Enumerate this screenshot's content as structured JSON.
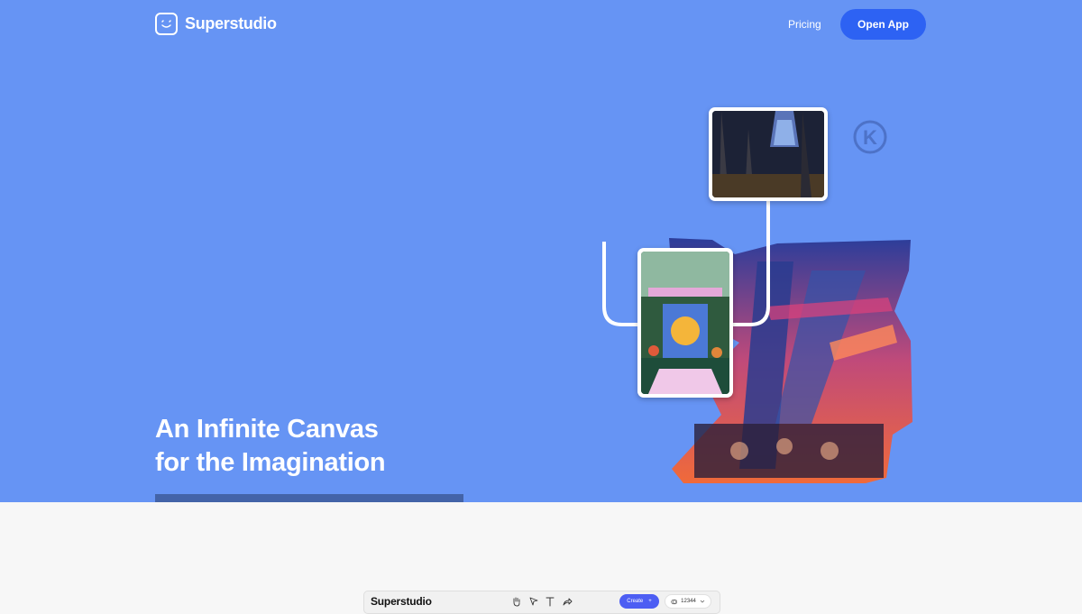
{
  "nav": {
    "brand": "Superstudio",
    "pricing_label": "Pricing",
    "open_app_label": "Open App"
  },
  "hero": {
    "headline_line1": "An Infinite Canvas",
    "headline_line2": "for the Imagination",
    "watermark_letter": "K"
  },
  "app_preview": {
    "brand": "Superstudio",
    "tools": [
      "hand-icon",
      "pointer-icon",
      "text-icon",
      "share-icon"
    ],
    "create_label": "Create",
    "create_plus": "+",
    "credits_value": "12344"
  },
  "colors": {
    "hero_bg": "#6694f4",
    "primary_button": "#2d62f3",
    "create_button": "#4d5ef3",
    "page_bg": "#f7f7f7"
  }
}
